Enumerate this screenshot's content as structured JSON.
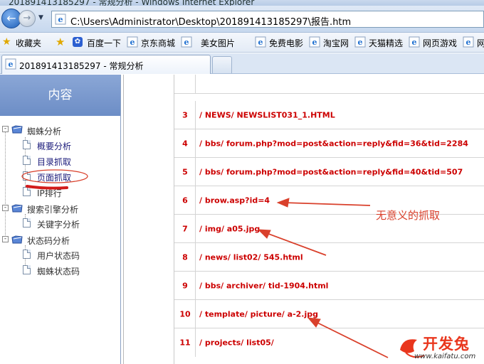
{
  "window": {
    "title": "201891413185297 - 常规分析 - Windows Internet Explorer"
  },
  "address_bar": {
    "url": "C:\\Users\\Administrator\\Desktop\\201891413185297\\报告.htm"
  },
  "favorites": {
    "label": "收藏夹",
    "items": [
      "百度一下",
      "京东商城",
      "美女图片",
      "免费电影",
      "淘宝网",
      "天猫精选",
      "网页游戏",
      "网"
    ]
  },
  "tab": {
    "title": "201891413185297 - 常规分析"
  },
  "sidebar": {
    "header": "内容",
    "groups": [
      {
        "label": "蜘蛛分析",
        "items": [
          "概要分析",
          "目录抓取",
          "页面抓取",
          "IP排行"
        ]
      },
      {
        "label": "搜索引擎分析",
        "items": [
          "关键字分析"
        ]
      },
      {
        "label": "状态码分析",
        "items": [
          "用户状态码",
          "蜘蛛状态码"
        ]
      }
    ]
  },
  "table": {
    "rows": [
      {
        "num": "",
        "url": ""
      },
      {
        "num": "3",
        "url": "/ NEWS/ NEWSLIST031_1.HTML"
      },
      {
        "num": "4",
        "url": "/ bbs/ forum.php?mod=post&action=reply&fid=36&tid=2284"
      },
      {
        "num": "5",
        "url": "/ bbs/ forum.php?mod=post&action=reply&fid=40&tid=507"
      },
      {
        "num": "6",
        "url": "/ brow.asp?id=4"
      },
      {
        "num": "7",
        "url": "/ img/ a05.jpg"
      },
      {
        "num": "8",
        "url": "/ news/ list02/ 545.html"
      },
      {
        "num": "9",
        "url": "/ bbs/ archiver/ tid-1904.html"
      },
      {
        "num": "10",
        "url": "/ template/ picture/ a-2.jpg"
      },
      {
        "num": "11",
        "url": "/ projects/ list05/"
      }
    ]
  },
  "annotation": {
    "text": "无意义的抓取"
  },
  "watermark": {
    "brand": "开发兔",
    "url": "www.kaifatu.com"
  },
  "colors": {
    "accent_red": "#cc0000",
    "annotation_red": "#d9402b",
    "sidebar_header": "#7a98cf"
  }
}
